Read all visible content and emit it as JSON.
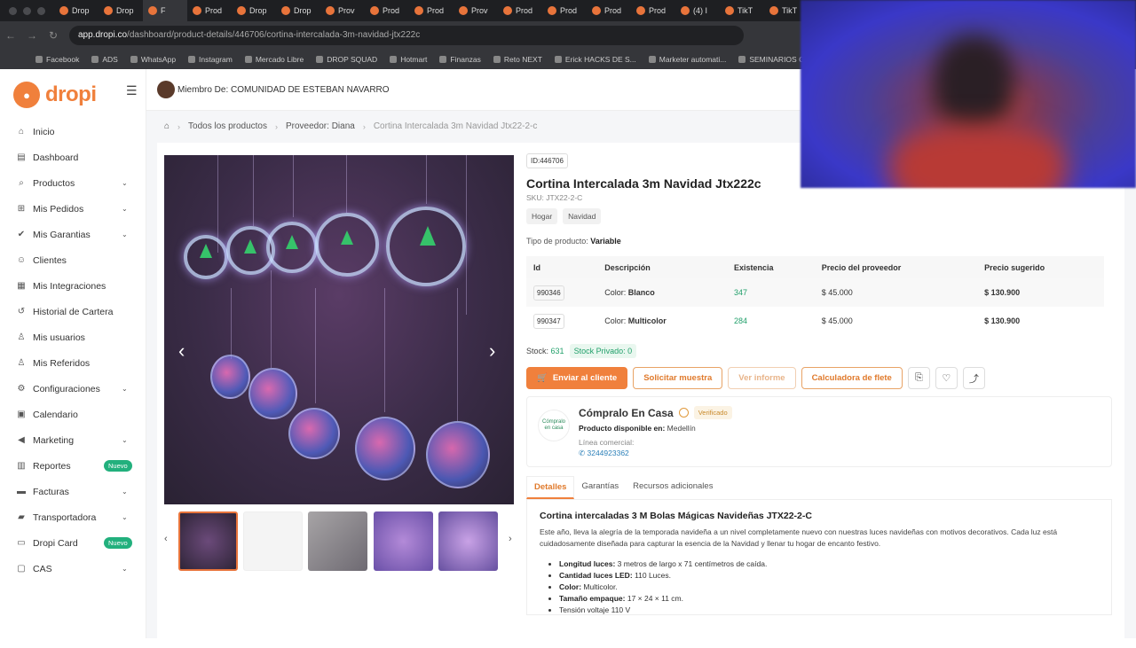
{
  "browser": {
    "tabs": [
      "Drop",
      "Drop",
      "F",
      "Prod",
      "Drop",
      "Drop",
      "Prov",
      "Prod",
      "Prod",
      "Prov",
      "Prod",
      "Prod",
      "Prod",
      "Prod",
      "(4) I",
      "TikT",
      "TikT"
    ],
    "url_host": "app.dropi.co",
    "url_path": "/dashboard/product-details/446706/cortina-intercalada-3m-navidad-jtx222c",
    "bookmarks": [
      "Facebook",
      "ADS",
      "WhatsApp",
      "Instagram",
      "Mercado Libre",
      "DROP SQUAD",
      "Hotmart",
      "Finanzas",
      "Reto NEXT",
      "Erick HACKS DE S...",
      "Marketer automati...",
      "SEMINARIOS C"
    ]
  },
  "brand": {
    "name": "dropi",
    "accent": "#f0803c"
  },
  "sidebar": {
    "items": [
      {
        "label": "Inicio",
        "icon": "home-icon",
        "chev": false
      },
      {
        "label": "Dashboard",
        "icon": "dashboard-icon",
        "chev": false
      },
      {
        "label": "Productos",
        "icon": "search-icon",
        "chev": true
      },
      {
        "label": "Mis Pedidos",
        "icon": "cart-icon",
        "chev": true
      },
      {
        "label": "Mis Garantias",
        "icon": "shield-check-icon",
        "chev": true
      },
      {
        "label": "Clientes",
        "icon": "clients-icon",
        "chev": false
      },
      {
        "label": "Mis Integraciones",
        "icon": "integrations-icon",
        "chev": false
      },
      {
        "label": "Historial de Cartera",
        "icon": "history-icon",
        "chev": false
      },
      {
        "label": "Mis usuarios",
        "icon": "users-icon",
        "chev": false
      },
      {
        "label": "Mis Referidos",
        "icon": "referrals-icon",
        "chev": false
      },
      {
        "label": "Configuraciones",
        "icon": "gear-icon",
        "chev": true
      },
      {
        "label": "Calendario",
        "icon": "calendar-icon",
        "chev": false
      },
      {
        "label": "Marketing",
        "icon": "megaphone-icon",
        "chev": true
      },
      {
        "label": "Reportes",
        "icon": "chart-icon",
        "chev": false,
        "badge": "Nuevo"
      },
      {
        "label": "Facturas",
        "icon": "invoice-icon",
        "chev": true
      },
      {
        "label": "Transportadora",
        "icon": "truck-icon",
        "chev": true
      },
      {
        "label": "Dropi Card",
        "icon": "card-icon",
        "chev": false,
        "badge": "Nuevo"
      },
      {
        "label": "CAS",
        "icon": "cas-icon",
        "chev": true
      }
    ]
  },
  "topbar": {
    "member": "Miembro De: COMUNIDAD DE ESTEBAN NAVARRO"
  },
  "breadcrumb": [
    "Todos los productos",
    "Proveedor: Diana",
    "Cortina Intercalada 3m Navidad Jtx22-2-c"
  ],
  "product": {
    "id_tag": "ID:446706",
    "title": "Cortina Intercalada 3m Navidad Jtx222c",
    "sku": "SKU: JTX22-2-C",
    "tags": [
      "Hogar",
      "Navidad"
    ],
    "type_label": "Tipo de producto:",
    "type_value": "Variable",
    "table": {
      "headers": [
        "Id",
        "Descripción",
        "Existencia",
        "Precio del proveedor",
        "Precio sugerido"
      ],
      "rows": [
        {
          "id": "990346",
          "desc_label": "Color:",
          "desc_value": "Blanco",
          "stock": "347",
          "supplier_price": "$ 45.000",
          "suggested": "$ 130.900"
        },
        {
          "id": "990347",
          "desc_label": "Color:",
          "desc_value": "Multicolor",
          "stock": "284",
          "supplier_price": "$ 45.000",
          "suggested": "$ 130.900"
        }
      ]
    },
    "stock_label": "Stock:",
    "stock_value": "631",
    "private_stock": "Stock Privado: 0",
    "actions": {
      "send": "Enviar al cliente",
      "sample": "Solicitar muestra",
      "report": "Ver informe",
      "freight": "Calculadora de flete"
    }
  },
  "supplier": {
    "logo_text": "Cómpralo en casa",
    "name": "Cómpralo En Casa",
    "verified": "Verificado",
    "availability_label": "Producto disponible en:",
    "availability_value": "Medellín",
    "line_label": "Línea comercial:",
    "phone": "3244923362"
  },
  "detail_tabs": [
    "Detalles",
    "Garantías",
    "Recursos adicionales"
  ],
  "description": {
    "heading": "Cortina intercaladas 3 M Bolas Mágicas Navideñas JTX22-2-C",
    "paragraph": "Este año, lleva la alegría de la temporada navideña a un nivel completamente nuevo con nuestras luces navideñas con motivos decorativos. Cada luz está cuidadosamente diseñada para capturar la esencia de la Navidad y llenar tu hogar de encanto festivo.",
    "bullets": [
      {
        "label": "Longitud luces:",
        "value": "3 metros de largo x 71 centímetros de caída."
      },
      {
        "label": "Cantidad luces LED:",
        "value": "110 Luces."
      },
      {
        "label": "Color:",
        "value": "Multicolor."
      },
      {
        "label": "Tamaño empaque:",
        "value": "17 × 24 × 11 cm."
      },
      {
        "label": "",
        "value": "Tensión voltaje 110 V"
      }
    ]
  }
}
